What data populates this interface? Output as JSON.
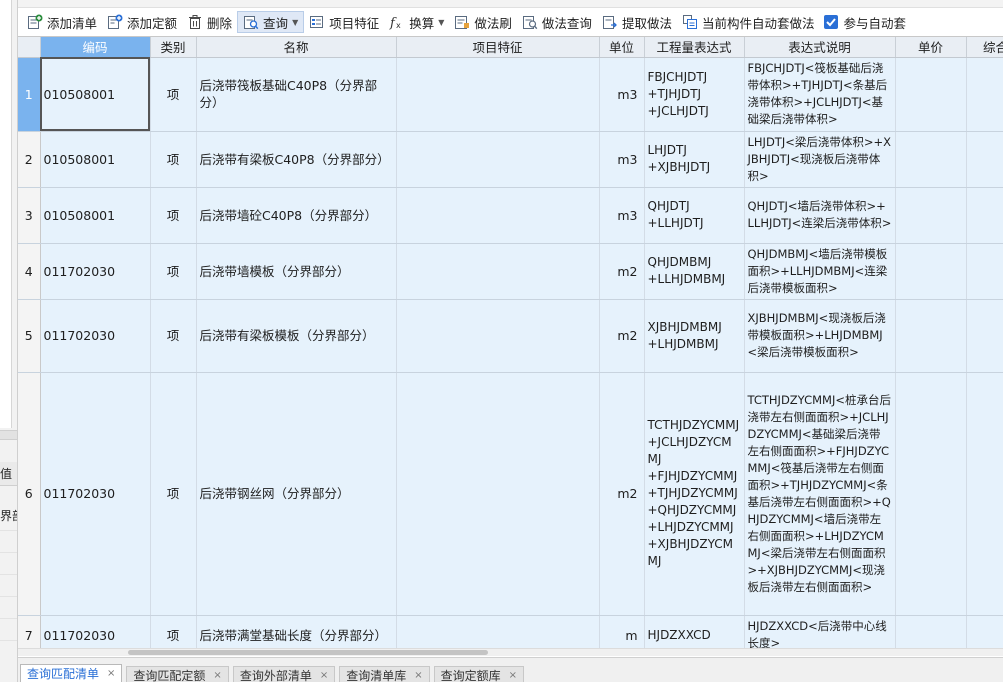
{
  "left_panel": {
    "header_text": "值",
    "value_text": "界部"
  },
  "toolbar": {
    "buttons": [
      {
        "id": "add-list",
        "label": "添加清单",
        "icon": "add-list-icon"
      },
      {
        "id": "add-quota",
        "label": "添加定额",
        "icon": "add-quota-icon"
      },
      {
        "id": "delete",
        "label": "删除",
        "icon": "trash-icon"
      },
      {
        "id": "query",
        "label": "查询",
        "icon": "query-icon"
      },
      {
        "id": "item-feature",
        "label": "项目特征",
        "icon": "feature-icon"
      },
      {
        "id": "convert",
        "label": "换算",
        "icon": "fx-icon"
      },
      {
        "id": "method-brush",
        "label": "做法刷",
        "icon": "method-brush-icon"
      },
      {
        "id": "method-query",
        "label": "做法查询",
        "icon": "method-query-icon"
      },
      {
        "id": "extract-method",
        "label": "提取做法",
        "icon": "extract-icon"
      },
      {
        "id": "auto-apply",
        "label": "当前构件自动套做法",
        "icon": "auto-apply-icon"
      }
    ],
    "checkbox": {
      "label": "参与自动套",
      "checked": true
    }
  },
  "grid": {
    "columns": [
      "编码",
      "类别",
      "名称",
      "项目特征",
      "单位",
      "工程量表达式",
      "表达式说明",
      "单价",
      "综合"
    ],
    "rows": [
      {
        "no": "1",
        "code": "010508001",
        "category": "项",
        "name": "后浇带筏板基础C40P8（分界部分）",
        "feature": "",
        "unit": "m3",
        "expr": "FBJCHJDTJ\n+TJHJDTJ\n+JCLHJDTJ",
        "desc": "FBJCHJDTJ<筏板基础后浇带体积>+TJHJDTJ<条基后浇带体积>+JCLHJDTJ<基础梁后浇带体积>"
      },
      {
        "no": "2",
        "code": "010508001",
        "category": "项",
        "name": "后浇带有梁板C40P8（分界部分）",
        "feature": "",
        "unit": "m3",
        "expr": "LHJDTJ\n+XJBHJDTJ",
        "desc": "LHJDTJ<梁后浇带体积>+XJBHJDTJ<现浇板后浇带体积>"
      },
      {
        "no": "3",
        "code": "010508001",
        "category": "项",
        "name": "后浇带墙砼C40P8（分界部分）",
        "feature": "",
        "unit": "m3",
        "expr": "QHJDTJ\n+LLHJDTJ",
        "desc": "QHJDTJ<墙后浇带体积>+LLHJDTJ<连梁后浇带体积>"
      },
      {
        "no": "4",
        "code": "011702030",
        "category": "项",
        "name": "后浇带墙模板（分界部分）",
        "feature": "",
        "unit": "m2",
        "expr": "QHJDMBMJ\n+LLHJDMBMJ",
        "desc": "QHJDMBMJ<墙后浇带模板面积>+LLHJDMBMJ<连梁后浇带模板面积>"
      },
      {
        "no": "5",
        "code": "011702030",
        "category": "项",
        "name": "后浇带有梁板模板（分界部分）",
        "feature": "",
        "unit": "m2",
        "expr": "XJBHJDMBMJ\n+LHJDMBMJ",
        "desc": "XJBHJDMBMJ<现浇板后浇带模板面积>+LHJDMBMJ<梁后浇带模板面积>"
      },
      {
        "no": "6",
        "code": "011702030",
        "category": "项",
        "name": "后浇带钢丝网（分界部分）",
        "feature": "",
        "unit": "m2",
        "expr": "TCTHJDZYCMMJ\n+JCLHJDZYCMMJ\n+FJHJDZYCMMJ\n+TJHJDZYCMMJ\n+QHJDZYCMMJ\n+LHJDZYCMMJ\n+XJBHJDZYCMMJ",
        "desc": "TCTHJDZYCMMJ<桩承台后浇带左右侧面面积>+JCLHJDZYCMMJ<基础梁后浇带左右侧面面积>+FJHJDZYCMMJ<筏基后浇带左右侧面面积>+TJHJDZYCMMJ<条基后浇带左右侧面面积>+QHJDZYCMMJ<墙后浇带左右侧面面积>+LHJDZYCMMJ<梁后浇带左右侧面面积>+XJBHJDZYCMMJ<现浇板后浇带左右侧面面积>"
      },
      {
        "no": "7",
        "code": "011702030",
        "category": "项",
        "name": "后浇带满堂基础长度（分界部分）",
        "feature": "",
        "unit": "m",
        "expr": "HJDZXXCD",
        "desc": "HJDZXXCD<后浇带中心线长度>"
      }
    ]
  },
  "tabs": [
    {
      "label": "查询匹配清单",
      "active": true
    },
    {
      "label": "查询匹配定额",
      "active": false
    },
    {
      "label": "查询外部清单",
      "active": false
    },
    {
      "label": "查询清单库",
      "active": false
    },
    {
      "label": "查询定额库",
      "active": false
    }
  ],
  "colors": {
    "header": "#e9eef4",
    "selected": "#7ab3ee",
    "row": "#e6f2fc",
    "accent": "#2a6fd6"
  }
}
